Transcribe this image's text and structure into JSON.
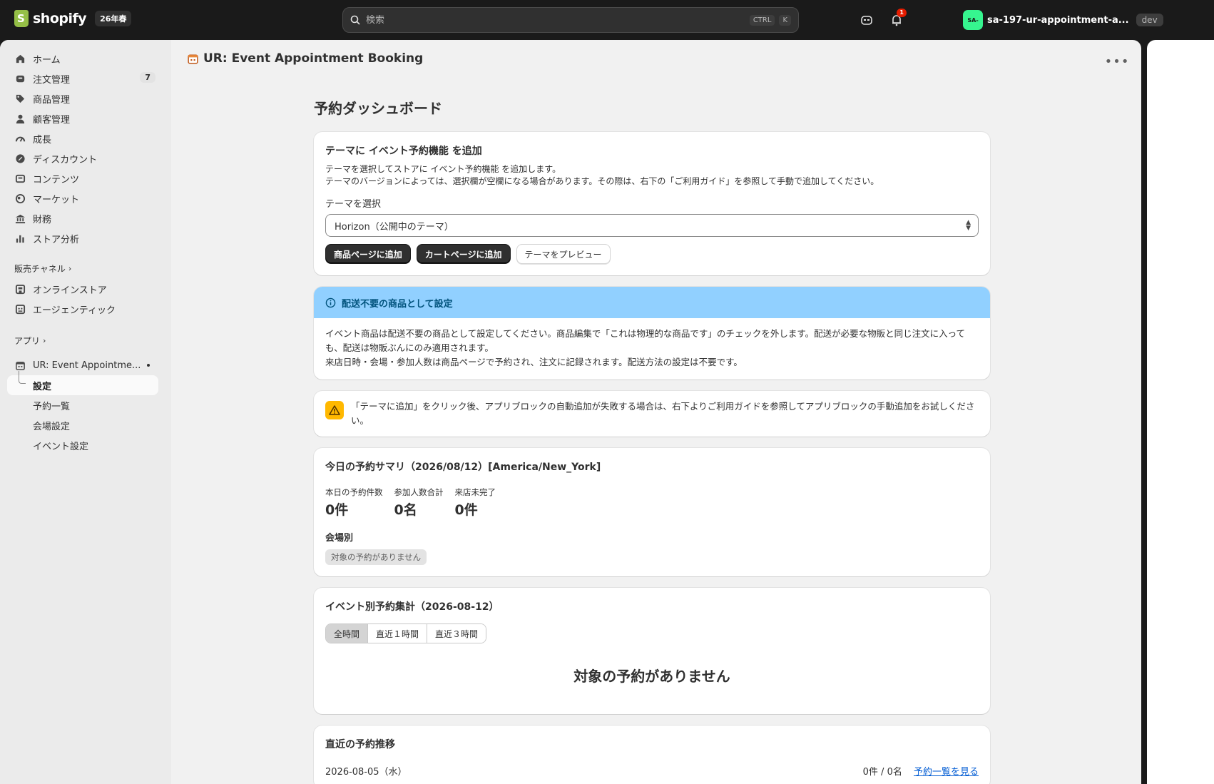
{
  "topbar": {
    "logo_text": "shopify",
    "logo_badge": "26年春",
    "search_placeholder": "検索",
    "shortcut_1": "CTRL",
    "shortcut_2": "K",
    "notification_count": "1",
    "store_avatar": "SA-",
    "store_name": "sa-197-ur-appointment-a...",
    "store_env": "dev"
  },
  "sidebar": {
    "items": [
      {
        "label": "ホーム",
        "icon": "home-icon"
      },
      {
        "label": "注文管理",
        "icon": "inbox-icon",
        "count": "7"
      },
      {
        "label": "商品管理",
        "icon": "tag-icon"
      },
      {
        "label": "顧客管理",
        "icon": "person-icon"
      },
      {
        "label": "成長",
        "icon": "gauge-icon"
      },
      {
        "label": "ディスカウント",
        "icon": "discount-icon"
      },
      {
        "label": "コンテンツ",
        "icon": "content-icon"
      },
      {
        "label": "マーケット",
        "icon": "globe-icon"
      },
      {
        "label": "財務",
        "icon": "bank-icon"
      },
      {
        "label": "ストア分析",
        "icon": "chart-icon"
      }
    ],
    "sales_channels_label": "販売チャネル",
    "channels": [
      {
        "label": "オンラインストア",
        "icon": "store-icon"
      },
      {
        "label": "エージェンティック",
        "icon": "agent-icon"
      }
    ],
    "apps_label": "アプリ",
    "app_name": "UR: Event Appointme...",
    "app_sub": [
      {
        "label": "設定"
      },
      {
        "label": "予約一覧"
      },
      {
        "label": "会場設定"
      },
      {
        "label": "イベント設定"
      }
    ]
  },
  "header": {
    "app_title": "UR: Event Appointment Booking"
  },
  "page": {
    "title": "予約ダッシュボード",
    "theme_card": {
      "title": "テーマに イベント予約機能 を追加",
      "line1": "テーマを選択してストアに イベント予約機能 を追加します。",
      "line2": "テーマのバージョンによっては、選択欄が空欄になる場合があります。その際は、右下の「ご利用ガイド」を参照して手動で追加してください。",
      "select_label": "テーマを選択",
      "select_value": "Horizon（公開中のテーマ）",
      "btn_product": "商品ページに追加",
      "btn_cart": "カートページに追加",
      "btn_preview": "テーマをプレビュー"
    },
    "shipping_banner": {
      "title": "配送不要の商品として設定",
      "line1": "イベント商品は配送不要の商品として設定してください。商品編集で「これは物理的な商品です」のチェックを外します。配送が必要な物販と同じ注文に入っても、配送は物販ぶんにのみ適用されます。",
      "line2": "来店日時・会場・参加人数は商品ページで予約され、注文に記録されます。配送方法の設定は不要です。"
    },
    "warning_banner": {
      "text": "「テーマに追加」をクリック後、アプリブロックの自動追加が失敗する場合は、右下よりご利用ガイドを参照してアプリブロックの手動追加をお試しください。"
    },
    "summary_card": {
      "title": "今日の予約サマリ（2026/08/12）[America/New_York]",
      "stats": [
        {
          "label": "本日の予約件数",
          "value": "0件"
        },
        {
          "label": "参加人数合計",
          "value": "0名"
        },
        {
          "label": "来店未完了",
          "value": "0件"
        }
      ],
      "by_venue_label": "会場別",
      "empty_chip": "対象の予約がありません"
    },
    "event_card": {
      "title": "イベント別予約集計（2026-08-12）",
      "tabs": [
        "全時間",
        "直近１時間",
        "直近３時間"
      ],
      "empty": "対象の予約がありません"
    },
    "recent_card": {
      "title": "直近の予約推移",
      "date": "2026-08-05（水）",
      "summary": "0件 / 0名",
      "link": "予約一覧を見る"
    }
  }
}
